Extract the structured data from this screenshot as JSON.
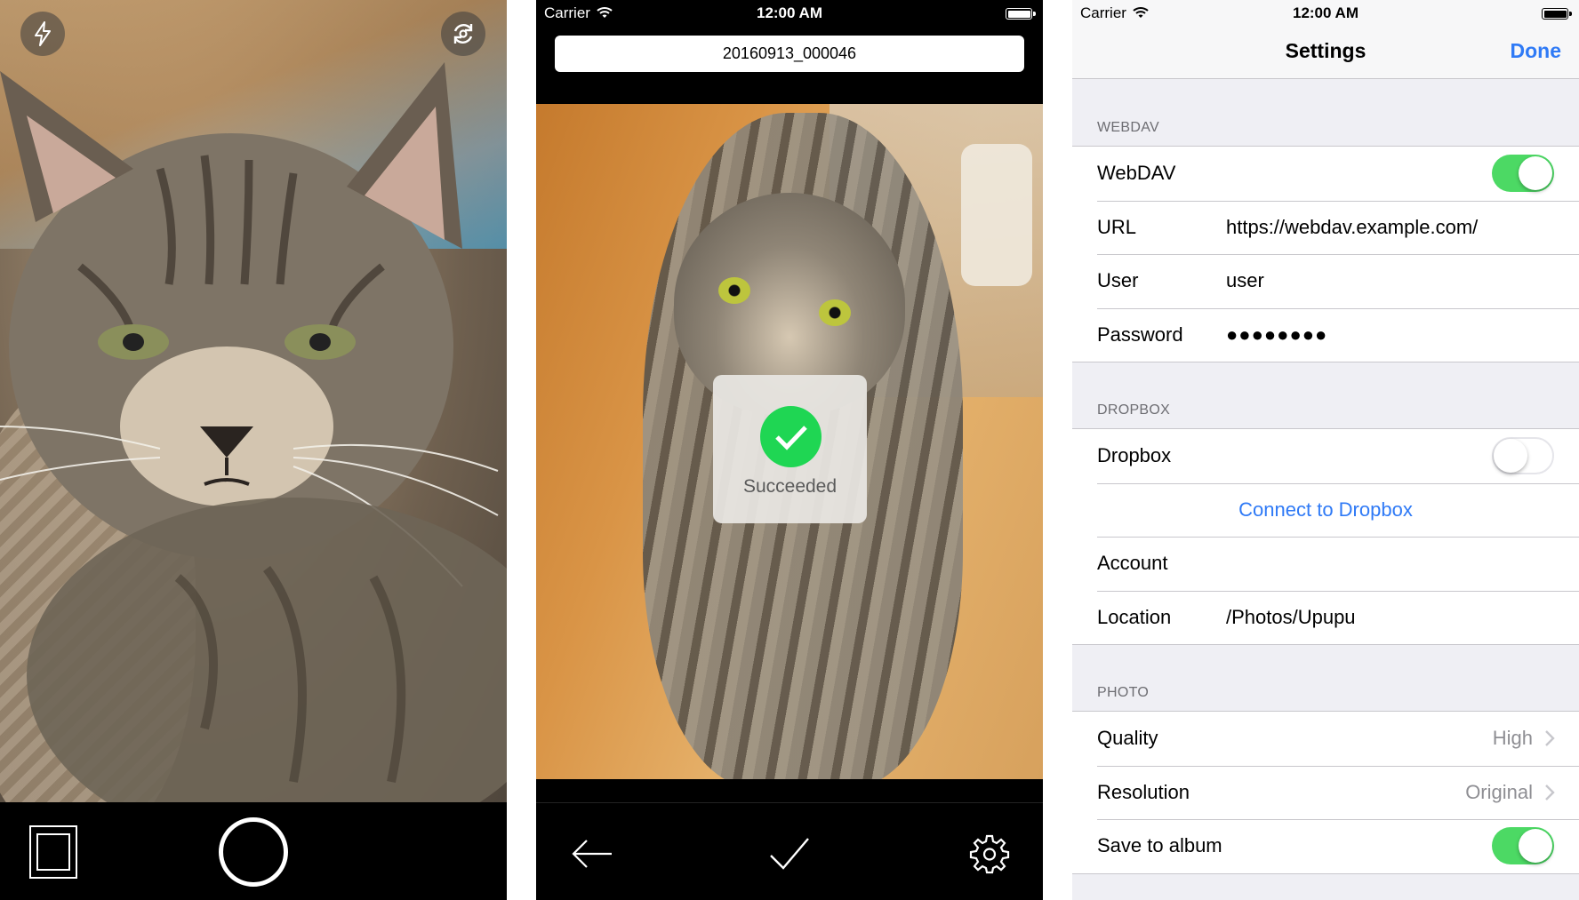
{
  "colors": {
    "ios_blue": "#2f7af6",
    "switch_on_green": "#4cd964",
    "success_green": "#1fd653",
    "grouped_background": "#efeff4"
  },
  "camera_screen": {
    "flash_icon": "lightning-bolt",
    "switch_camera_icon": "rotate-camera",
    "gallery_icon": "stacked-squares",
    "shutter_icon": "circle-ring"
  },
  "upload_screen": {
    "status_bar": {
      "carrier": "Carrier",
      "time": "12:00 AM"
    },
    "filename": "20160913_000046",
    "hud": {
      "icon": "checkmark-circle",
      "label": "Succeeded"
    },
    "toolbar": {
      "back_icon": "arrow-left",
      "confirm_icon": "checkmark",
      "settings_icon": "gear"
    }
  },
  "settings_screen": {
    "status_bar": {
      "carrier": "Carrier",
      "time": "12:00 AM"
    },
    "nav": {
      "title": "Settings",
      "done": "Done"
    },
    "webdav": {
      "header": "WEBDAV",
      "toggle_label": "WebDAV",
      "toggle_on": true,
      "url_label": "URL",
      "url_value": "https://webdav.example.com/",
      "user_label": "User",
      "user_value": "user",
      "password_label": "Password",
      "password_value": "●●●●●●●●"
    },
    "dropbox": {
      "header": "DROPBOX",
      "toggle_label": "Dropbox",
      "toggle_on": false,
      "connect_link": "Connect to Dropbox",
      "account_label": "Account",
      "account_value": "",
      "location_label": "Location",
      "location_value": "/Photos/Upupu"
    },
    "photo": {
      "header": "PHOTO",
      "quality_label": "Quality",
      "quality_value": "High",
      "resolution_label": "Resolution",
      "resolution_value": "Original",
      "save_label": "Save to album",
      "save_on": true
    }
  }
}
